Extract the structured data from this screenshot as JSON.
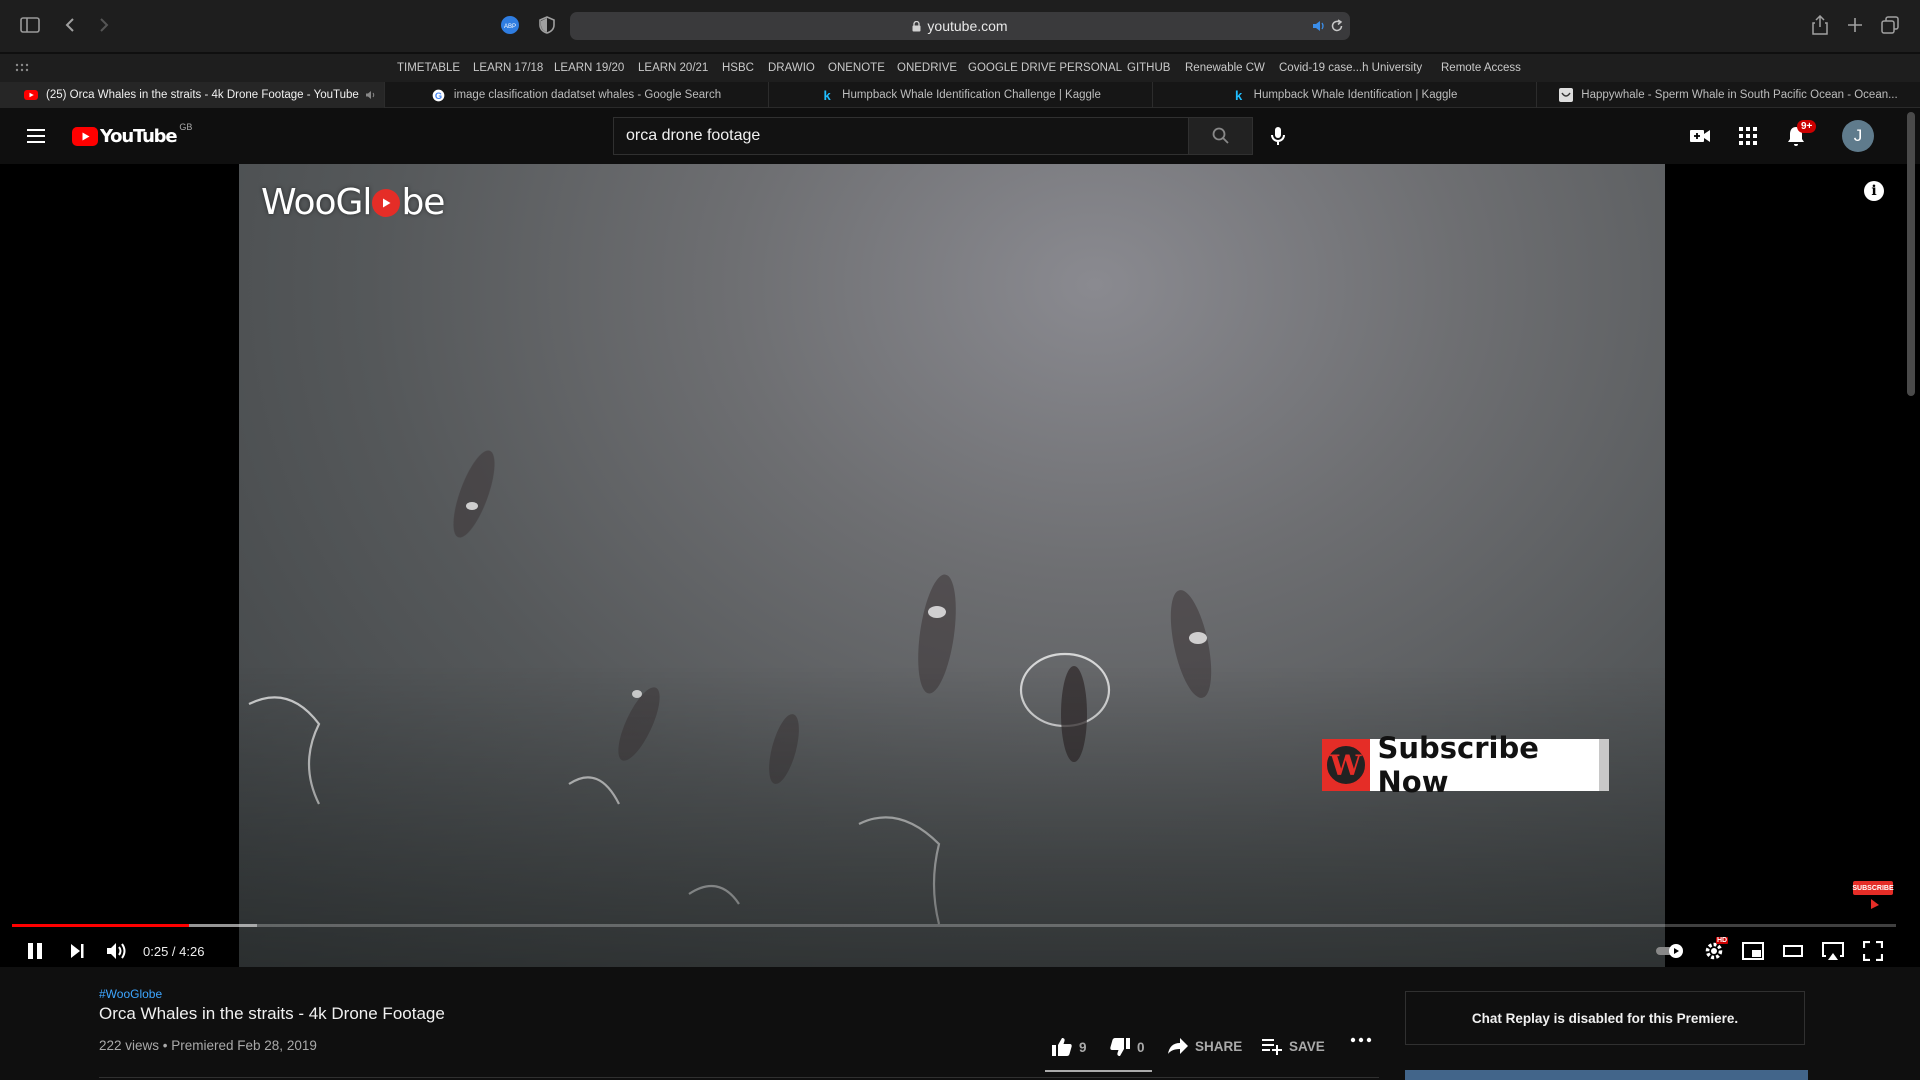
{
  "browser": {
    "url": "youtube.com",
    "bookmarks": [
      "TIMETABLE",
      "LEARN 17/18",
      "LEARN 19/20",
      "LEARN 20/21",
      "HSBC",
      "DRAWIO",
      "ONENOTE",
      "ONEDRIVE",
      "GOOGLE DRIVE PERSONAL",
      "GITHUB",
      "Renewable CW",
      "Covid-19 case...h University",
      "Remote Access"
    ],
    "tabs": [
      {
        "label": "(25) Orca Whales in the straits - 4k Drone Footage - YouTube",
        "active": true
      },
      {
        "label": "image clasification dadatset whales - Google Search"
      },
      {
        "label": "Humpback Whale Identification Challenge | Kaggle"
      },
      {
        "label": "Humpback Whale Identification | Kaggle"
      },
      {
        "label": "Happywhale - Sperm Whale in South Pacific Ocean - Ocean..."
      }
    ]
  },
  "youtube": {
    "logo_text": "YouTube",
    "region": "GB",
    "search_query": "orca drone footage",
    "notifications": "9+",
    "avatar_letter": "J"
  },
  "player": {
    "watermark_left": "WooGl",
    "watermark_right": "be",
    "subscribe_banner": "Subscribe Now",
    "endscreen_subscribe": "SUBSCRIBE",
    "time": "0:25 / 4:26",
    "played_fraction": 0.094,
    "buffered_fraction": 0.13,
    "hd_badge": "HD"
  },
  "video": {
    "hashtag": "#WooGlobe",
    "title": "Orca Whales in the straits - 4k Drone Footage",
    "views": "222 views • Premiered Feb 28, 2019",
    "likes": "9",
    "dislikes": "0",
    "share_label": "SHARE",
    "save_label": "SAVE",
    "like_fraction": 1.0
  },
  "chat": {
    "message": "Chat Replay is disabled for this Premiere."
  },
  "colors": {
    "accent": "#ff0000",
    "link": "#3ea6ff"
  }
}
